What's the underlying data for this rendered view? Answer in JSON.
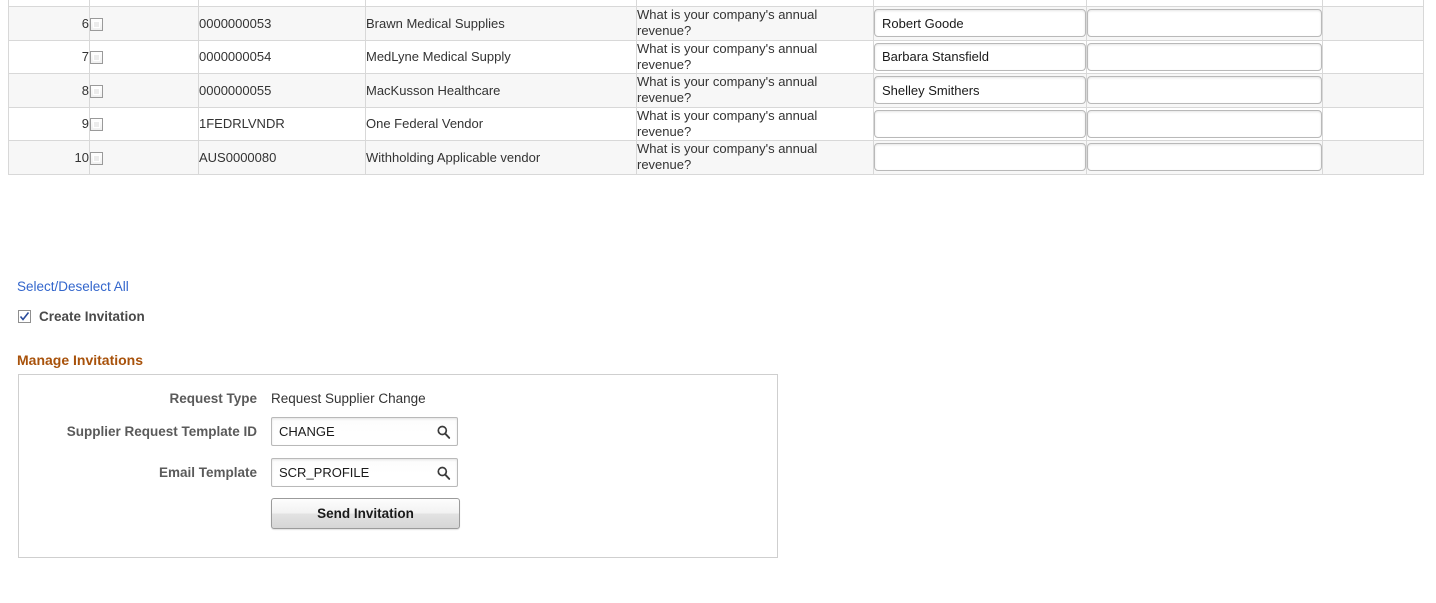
{
  "grid": {
    "columns": [
      "row-number",
      "select-checkbox",
      "supplier-id",
      "supplier-name",
      "question",
      "contact-name",
      "extra-field",
      "tail"
    ],
    "rows": [
      {
        "num": "6",
        "id": "0000000053",
        "name": "Brawn Medical Supplies",
        "question": "What is your company's annual revenue?",
        "contact": "Robert Goode",
        "extra": "",
        "checked": false
      },
      {
        "num": "7",
        "id": "0000000054",
        "name": "MedLyne Medical Supply",
        "question": "What is your company's annual revenue?",
        "contact": "Barbara Stansfield",
        "extra": "",
        "checked": false
      },
      {
        "num": "8",
        "id": "0000000055",
        "name": "MacKusson Healthcare",
        "question": "What is your company's annual revenue?",
        "contact": "Shelley Smithers",
        "extra": "",
        "checked": false
      },
      {
        "num": "9",
        "id": "1FEDRLVNDR",
        "name": "One Federal Vendor",
        "question": "What is your company's annual revenue?",
        "contact": "",
        "extra": "",
        "checked": false
      },
      {
        "num": "10",
        "id": "AUS0000080",
        "name": "Withholding Applicable vendor",
        "question": "What is your company's annual revenue?",
        "contact": "",
        "extra": "",
        "checked": false
      }
    ]
  },
  "actions": {
    "select_deselect_all": "Select/Deselect All",
    "create_invitation_label": "Create Invitation",
    "create_invitation_checked": true
  },
  "manage_invitations": {
    "heading": "Manage Invitations",
    "request_type_label": "Request Type",
    "request_type_value": "Request Supplier Change",
    "template_id_label": "Supplier Request Template ID",
    "template_id_value": "CHANGE",
    "email_template_label": "Email Template",
    "email_template_value": "SCR_PROFILE",
    "send_button_label": "Send Invitation",
    "lookup_icon": "search-icon"
  },
  "colors": {
    "link": "#3366cc",
    "heading_accent": "#a8520b",
    "label_text": "#5a5a5a",
    "row_alt_bg": "#f7f7f7",
    "grid_border": "#d8d8d8"
  }
}
